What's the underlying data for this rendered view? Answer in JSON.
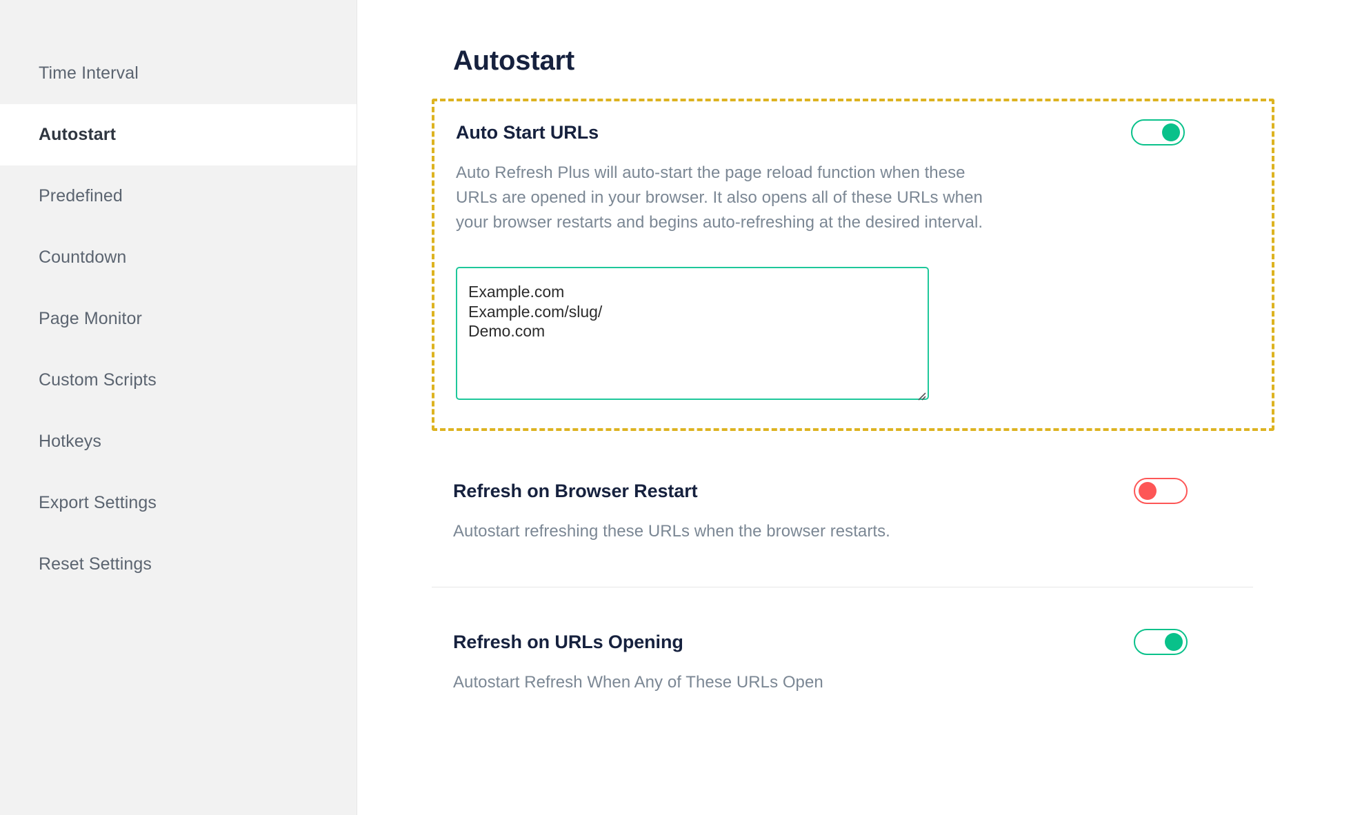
{
  "sidebar": {
    "items": [
      {
        "label": "Time Interval",
        "active": false
      },
      {
        "label": "Autostart",
        "active": true
      },
      {
        "label": "Predefined",
        "active": false
      },
      {
        "label": "Countdown",
        "active": false
      },
      {
        "label": "Page Monitor",
        "active": false
      },
      {
        "label": "Custom Scripts",
        "active": false
      },
      {
        "label": "Hotkeys",
        "active": false
      },
      {
        "label": "Export Settings",
        "active": false
      },
      {
        "label": "Reset Settings",
        "active": false
      }
    ]
  },
  "main": {
    "page_title": "Autostart",
    "sections": {
      "auto_start_urls": {
        "title": "Auto Start URLs",
        "description": "Auto Refresh Plus will auto-start the page reload function when these URLs are opened in your browser. It also opens all of these URLs when your browser restarts and begins auto-refreshing at the desired interval.",
        "toggle_state": "on",
        "urls_value": "Example.com\nExample.com/slug/\nDemo.com",
        "urls_placeholder": "Example.com"
      },
      "refresh_on_browser_restart": {
        "title": "Refresh on Browser Restart",
        "description": "Autostart refreshing these URLs when the browser restarts.",
        "toggle_state": "off"
      },
      "refresh_on_urls_opening": {
        "title": "Refresh on URLs Opening",
        "description": "Autostart Refresh When Any of These URLs Open",
        "toggle_state": "on"
      }
    }
  },
  "colors": {
    "accent_green": "#09c18a",
    "accent_red": "#fd5656",
    "highlight_yellow": "#ddb321",
    "title_navy": "#16213e",
    "muted_text": "#7b8794",
    "sidebar_bg": "#f2f2f2"
  }
}
